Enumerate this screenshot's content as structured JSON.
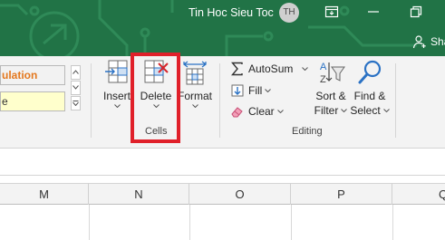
{
  "window": {
    "title": "Tin Hoc Sieu Toc",
    "user_initials": "TH",
    "share_label": "Sha",
    "icons": [
      "ribbon-display-options-icon",
      "minimize-icon",
      "restore-icon",
      "share-person-icon"
    ]
  },
  "ribbon": {
    "styles": {
      "calculation_label": "ulation",
      "note_label": "e"
    },
    "cells_group": {
      "insert_label": "Insert",
      "delete_label": "Delete",
      "format_label": "Format",
      "group_label": "Cells"
    },
    "editing_group": {
      "autosum_label": "AutoSum",
      "fill_label": "Fill",
      "clear_label": "Clear",
      "sort_filter_line1": "Sort &",
      "sort_filter_line2": "Filter",
      "find_select_line1": "Find &",
      "find_select_line2": "Select",
      "group_label": "Editing"
    }
  },
  "sheet": {
    "columns": [
      "M",
      "N",
      "O",
      "P",
      "Q"
    ]
  },
  "colors": {
    "title_bar": "#217346",
    "highlight_box": "#e0202a",
    "calculation_style_text": "#e4781e",
    "note_style_fill": "#ffffcc"
  }
}
